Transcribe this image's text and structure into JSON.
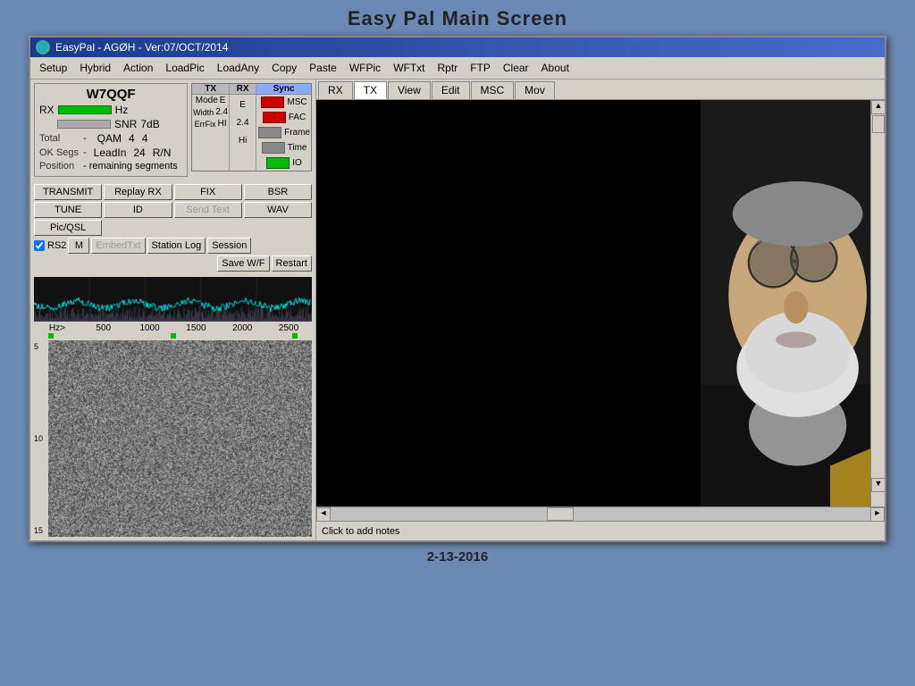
{
  "slide_title": "Easy Pal  Main  Screen",
  "window": {
    "title_bar": "EasyPal - AGØH - Ver:07/OCT/2014",
    "menu_items": [
      "Setup",
      "Hybrid",
      "Action",
      "LoadPic",
      "LoadAny",
      "Copy",
      "Paste",
      "WFPic",
      "WFTxt",
      "Rptr",
      "FTP",
      "Clear",
      "About"
    ]
  },
  "left_panel": {
    "callsign": "W7QQF",
    "mode_label": "Mode",
    "mode_tx": "E",
    "mode_rx": "E",
    "width_label": "Width",
    "width_tx": "2.4",
    "width_rx": "2.4",
    "errfix_label": "ErrFix",
    "errfix_tx": "HI",
    "errfix_rx": "Hi",
    "qam_label": "QAM",
    "qam_val": "4",
    "qam_val2": "4",
    "leadin_label": "LeadIn",
    "leadin_val": "24",
    "leadin_rn": "R/N",
    "rx_label": "RX",
    "rx_hz": "Hz",
    "snr_label": "SNR",
    "snr_val": "7dB",
    "total_label": "Total",
    "total_val": "-",
    "ok_segs_label": "OK Segs",
    "ok_segs_val": "-",
    "position_label": "Position",
    "position_val": "-  remaining segments",
    "indicators": {
      "tx_header": "TX",
      "rx_header": "RX",
      "sync_header": "Sync",
      "msc_label": "MSC",
      "fac_label": "FAC",
      "frame_label": "Frame",
      "time_label": "Time",
      "io_label": "IO"
    },
    "buttons": [
      "TRANSMIT",
      "Replay RX",
      "FIX",
      "BSR",
      "TUNE",
      "ID",
      "Send Text",
      "WAV",
      "Pic/QSL",
      "RS2",
      "M",
      "EmbedTxt",
      "Station Log",
      "Session",
      "",
      "",
      "Save W/F",
      "Restart"
    ],
    "hz_labels": [
      "Hz>",
      "500",
      "1000",
      "1500",
      "2000",
      "2500"
    ],
    "waterfall_y": [
      "5",
      "10",
      "15"
    ]
  },
  "right_panel": {
    "tabs": [
      "RX",
      "TX",
      "View",
      "Edit",
      "MSC",
      "Mov"
    ]
  },
  "bottom": {
    "notes_text": "Click to add notes",
    "date_text": "2-13-2016"
  }
}
